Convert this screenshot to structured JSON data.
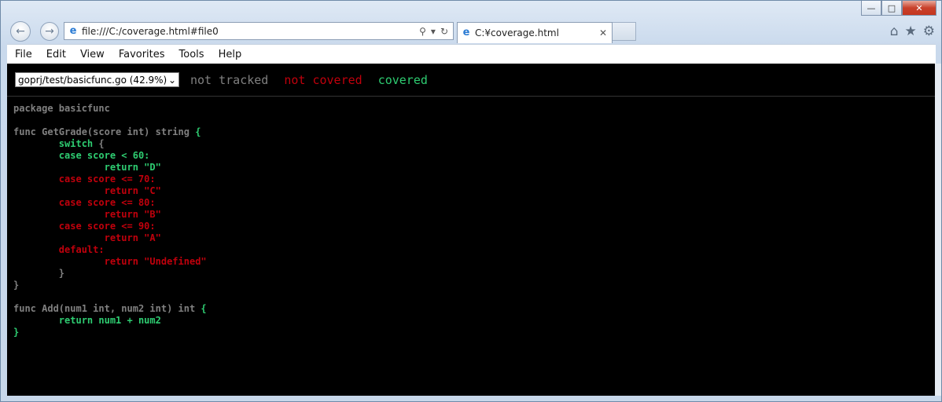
{
  "window": {
    "minimize_icon": "minimize-icon",
    "maximize_icon": "maximize-icon",
    "close_icon": "close-icon"
  },
  "nav": {
    "back_icon": "back-arrow-icon",
    "forward_icon": "forward-arrow-icon",
    "address": "file:///C:/coverage.html#file0",
    "tab_title": "C:¥coverage.html"
  },
  "menu": {
    "items": [
      "File",
      "Edit",
      "View",
      "Favorites",
      "Tools",
      "Help"
    ]
  },
  "coverage": {
    "selected_file": "goprj/test/basicfunc.go (42.9%)",
    "legend": {
      "not_tracked": "not tracked",
      "not_covered": "not covered",
      "covered": "covered"
    },
    "colors": {
      "not_tracked": "#808080",
      "not_covered": "#c0000c",
      "covered": "#2ecc71",
      "background": "#000000"
    }
  },
  "code_lines": [
    {
      "segments": [
        {
          "t": "package basicfunc",
          "c": "nt"
        }
      ]
    },
    {
      "segments": [
        {
          "t": "",
          "c": "nt"
        }
      ]
    },
    {
      "segments": [
        {
          "t": "func GetGrade(score int) string ",
          "c": "nt"
        },
        {
          "t": "{",
          "c": "cv"
        }
      ]
    },
    {
      "segments": [
        {
          "t": "        ",
          "c": "nt"
        },
        {
          "t": "switch",
          "c": "cv"
        },
        {
          "t": " {",
          "c": "nt"
        }
      ]
    },
    {
      "segments": [
        {
          "t": "        ",
          "c": "nt"
        },
        {
          "t": "case score < 60:",
          "c": "cv"
        }
      ]
    },
    {
      "segments": [
        {
          "t": "                ",
          "c": "nt"
        },
        {
          "t": "return \"D\"",
          "c": "cv"
        }
      ]
    },
    {
      "segments": [
        {
          "t": "        ",
          "c": "nt"
        },
        {
          "t": "case score <= 70:",
          "c": "nc"
        }
      ]
    },
    {
      "segments": [
        {
          "t": "                ",
          "c": "nt"
        },
        {
          "t": "return \"C\"",
          "c": "nc"
        }
      ]
    },
    {
      "segments": [
        {
          "t": "        ",
          "c": "nt"
        },
        {
          "t": "case score <= 80:",
          "c": "nc"
        }
      ]
    },
    {
      "segments": [
        {
          "t": "                ",
          "c": "nt"
        },
        {
          "t": "return \"B\"",
          "c": "nc"
        }
      ]
    },
    {
      "segments": [
        {
          "t": "        ",
          "c": "nt"
        },
        {
          "t": "case score <= 90:",
          "c": "nc"
        }
      ]
    },
    {
      "segments": [
        {
          "t": "                ",
          "c": "nt"
        },
        {
          "t": "return \"A\"",
          "c": "nc"
        }
      ]
    },
    {
      "segments": [
        {
          "t": "        ",
          "c": "nt"
        },
        {
          "t": "default:",
          "c": "nc"
        }
      ]
    },
    {
      "segments": [
        {
          "t": "                ",
          "c": "nt"
        },
        {
          "t": "return \"Undefined\"",
          "c": "nc"
        }
      ]
    },
    {
      "segments": [
        {
          "t": "        }",
          "c": "nt"
        }
      ]
    },
    {
      "segments": [
        {
          "t": "}",
          "c": "nt"
        }
      ]
    },
    {
      "segments": [
        {
          "t": "",
          "c": "nt"
        }
      ]
    },
    {
      "segments": [
        {
          "t": "func Add(num1 int, num2 int) int ",
          "c": "nt"
        },
        {
          "t": "{",
          "c": "cv"
        }
      ]
    },
    {
      "segments": [
        {
          "t": "        ",
          "c": "nt"
        },
        {
          "t": "return num1 + num2",
          "c": "cv"
        }
      ]
    },
    {
      "segments": [
        {
          "t": "}",
          "c": "cv"
        }
      ]
    }
  ]
}
